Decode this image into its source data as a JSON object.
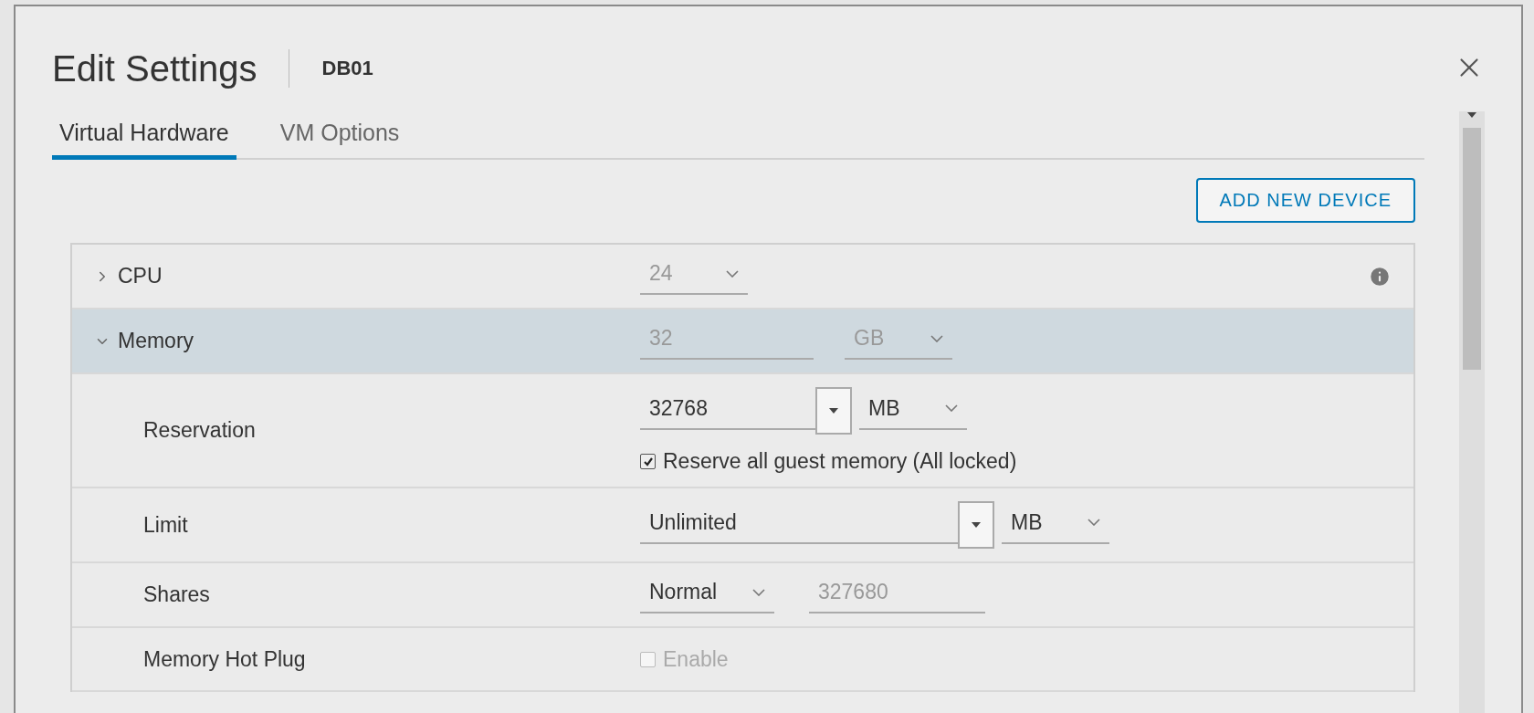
{
  "dialog": {
    "title": "Edit Settings",
    "subtitle": "DB01"
  },
  "tabs": [
    {
      "label": "Virtual Hardware",
      "selected": true
    },
    {
      "label": "VM Options",
      "selected": false
    }
  ],
  "add_button": "ADD NEW DEVICE",
  "rows": [
    {
      "kind": "group",
      "label": "CPU",
      "expanded": false,
      "selected": false,
      "value": "24",
      "info": true
    },
    {
      "kind": "group",
      "label": "Memory",
      "expanded": true,
      "selected": true,
      "value": "32",
      "unit": "GB"
    },
    {
      "kind": "amount",
      "label": "Reservation",
      "value": "32768",
      "unit": "MB",
      "checkbox": {
        "label": "Reserve all guest memory (All locked)",
        "checked": true,
        "disabled": false
      }
    },
    {
      "kind": "amount",
      "label": "Limit",
      "value": "Unlimited",
      "unit": "MB"
    },
    {
      "kind": "shares",
      "label": "Shares",
      "value": "Normal",
      "amount": "327680"
    },
    {
      "kind": "check",
      "label": "Memory Hot Plug",
      "checkbox": {
        "label": "Enable",
        "checked": false,
        "disabled": true
      }
    }
  ]
}
